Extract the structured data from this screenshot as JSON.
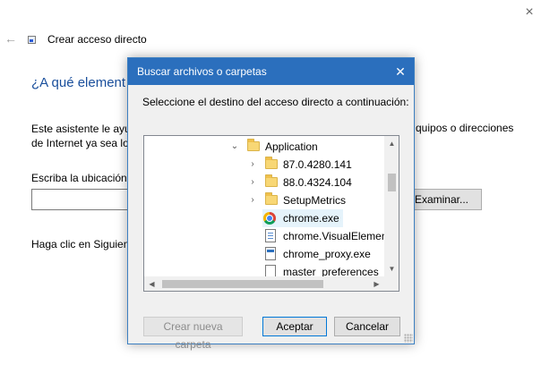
{
  "wizard": {
    "close_icon": "×",
    "back_icon": "←",
    "title": "Crear acceso directo",
    "heading": "¿A qué element",
    "description_line1": "Este asistente le ayud",
    "description_line2": "de Internet ya sea loc",
    "description_right": "quipos o direcciones",
    "location_label": "Escriba la ubicación",
    "location_value": "",
    "browse_button": "Examinar...",
    "next_instruction": "Haga clic en Siguient"
  },
  "dialog": {
    "title": "Buscar archivos o carpetas",
    "close_icon": "✕",
    "prompt": "Seleccione el destino del acceso directo a continuación:",
    "tree": [
      {
        "label": "Application",
        "icon": "folder-icon",
        "expander": "expanded"
      },
      {
        "label": "87.0.4280.141",
        "icon": "folder-icon",
        "expander": "collapsed"
      },
      {
        "label": "88.0.4324.104",
        "icon": "folder-icon",
        "expander": "collapsed"
      },
      {
        "label": "SetupMetrics",
        "icon": "folder-icon",
        "expander": "collapsed"
      },
      {
        "label": "chrome.exe",
        "icon": "chrome-icon",
        "expander": "none",
        "selected": true
      },
      {
        "label": "chrome.VisualElement",
        "icon": "visual-elements-file-icon",
        "expander": "none"
      },
      {
        "label": "chrome_proxy.exe",
        "icon": "exe-file-icon",
        "expander": "none"
      },
      {
        "label": "master_preferences",
        "icon": "file-icon",
        "expander": "none"
      }
    ],
    "buttons": {
      "new_folder": "Crear nueva carpeta",
      "ok": "Aceptar",
      "cancel": "Cancelar"
    }
  },
  "colors": {
    "dialog_titlebar": "#2b6fbd",
    "heading_blue": "#1a4f9c",
    "selection": "#e5f3fb",
    "folder": "#f8d775"
  }
}
